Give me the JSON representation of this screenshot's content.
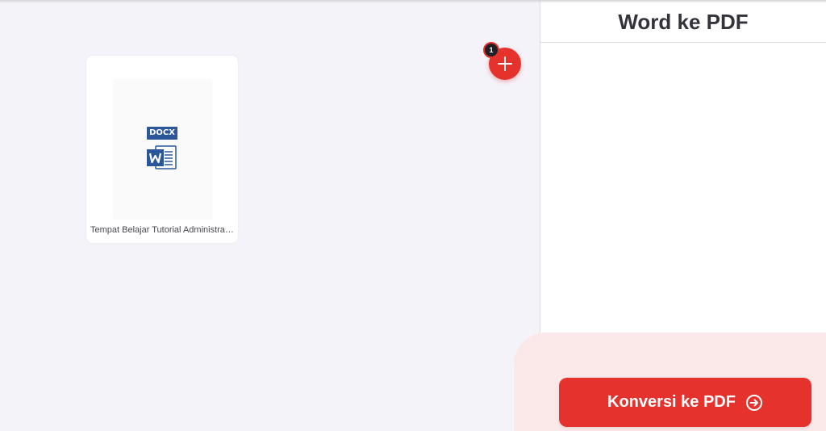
{
  "workspace": {
    "file": {
      "type_badge": "DOCX",
      "icon": "word-file-icon",
      "name": "Tempat Belajar Tutorial Administrasi Perkantoran.docx"
    },
    "add_button": {
      "icon": "plus-icon",
      "count": "1"
    }
  },
  "side_panel": {
    "title": "Word ke PDF",
    "convert_button": {
      "label": "Konversi ke PDF",
      "icon": "arrow-right-circle-icon"
    }
  },
  "colors": {
    "accent": "#e5322d",
    "word_blue": "#2b579a",
    "footer_tint": "#fbe8e8",
    "workspace_bg": "#f4f3fa"
  }
}
